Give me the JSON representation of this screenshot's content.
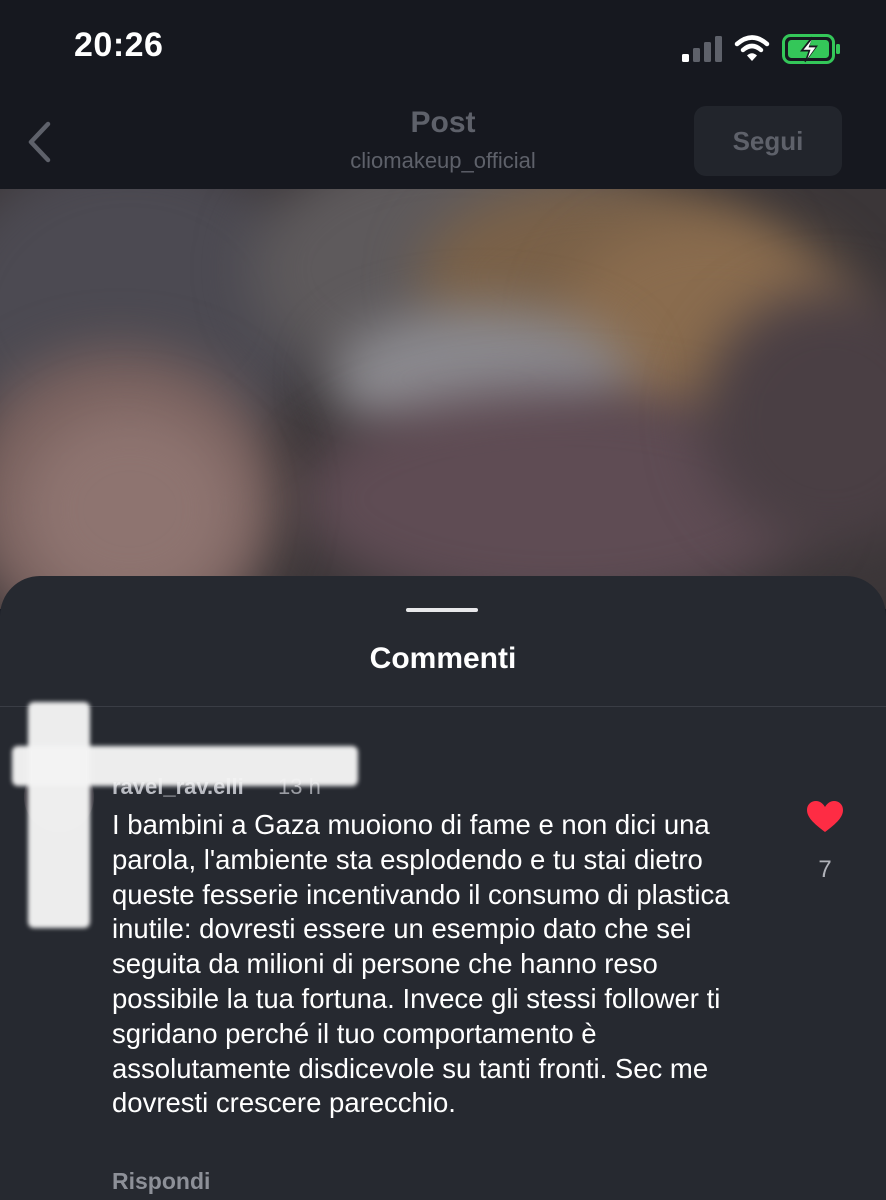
{
  "status_bar": {
    "time": "20:26",
    "icons": [
      "signal-icon",
      "wifi-icon",
      "battery-charging-icon"
    ]
  },
  "header": {
    "title": "Post",
    "subtitle": "cliomakeup_official",
    "follow_label": "Segui",
    "back_icon": "chevron-left-icon"
  },
  "comments": {
    "title": "Commenti",
    "items": [
      {
        "username": "ravel_rav.elli",
        "time": "13 h",
        "text": "I bambini a Gaza muoiono di fame e non dici una parola, l'ambiente sta esplodendo e tu stai dietro queste fesserie incentivando il consumo di plastica inutile: dovresti essere un esempio dato che sei seguita da milioni di persone che hanno reso possibile la tua fortuna. Invece gli stessi follower ti sgridano perché il tuo comportamento è assolutamente disdicevole su tanti fronti. Sec me dovresti crescere parecchio.",
        "reply_label": "Rispondi",
        "like_count": "7",
        "liked": true
      }
    ]
  },
  "colors": {
    "background": "#141720",
    "sheet": "#262930",
    "like": "#fe2c44",
    "battery": "#34c759"
  }
}
